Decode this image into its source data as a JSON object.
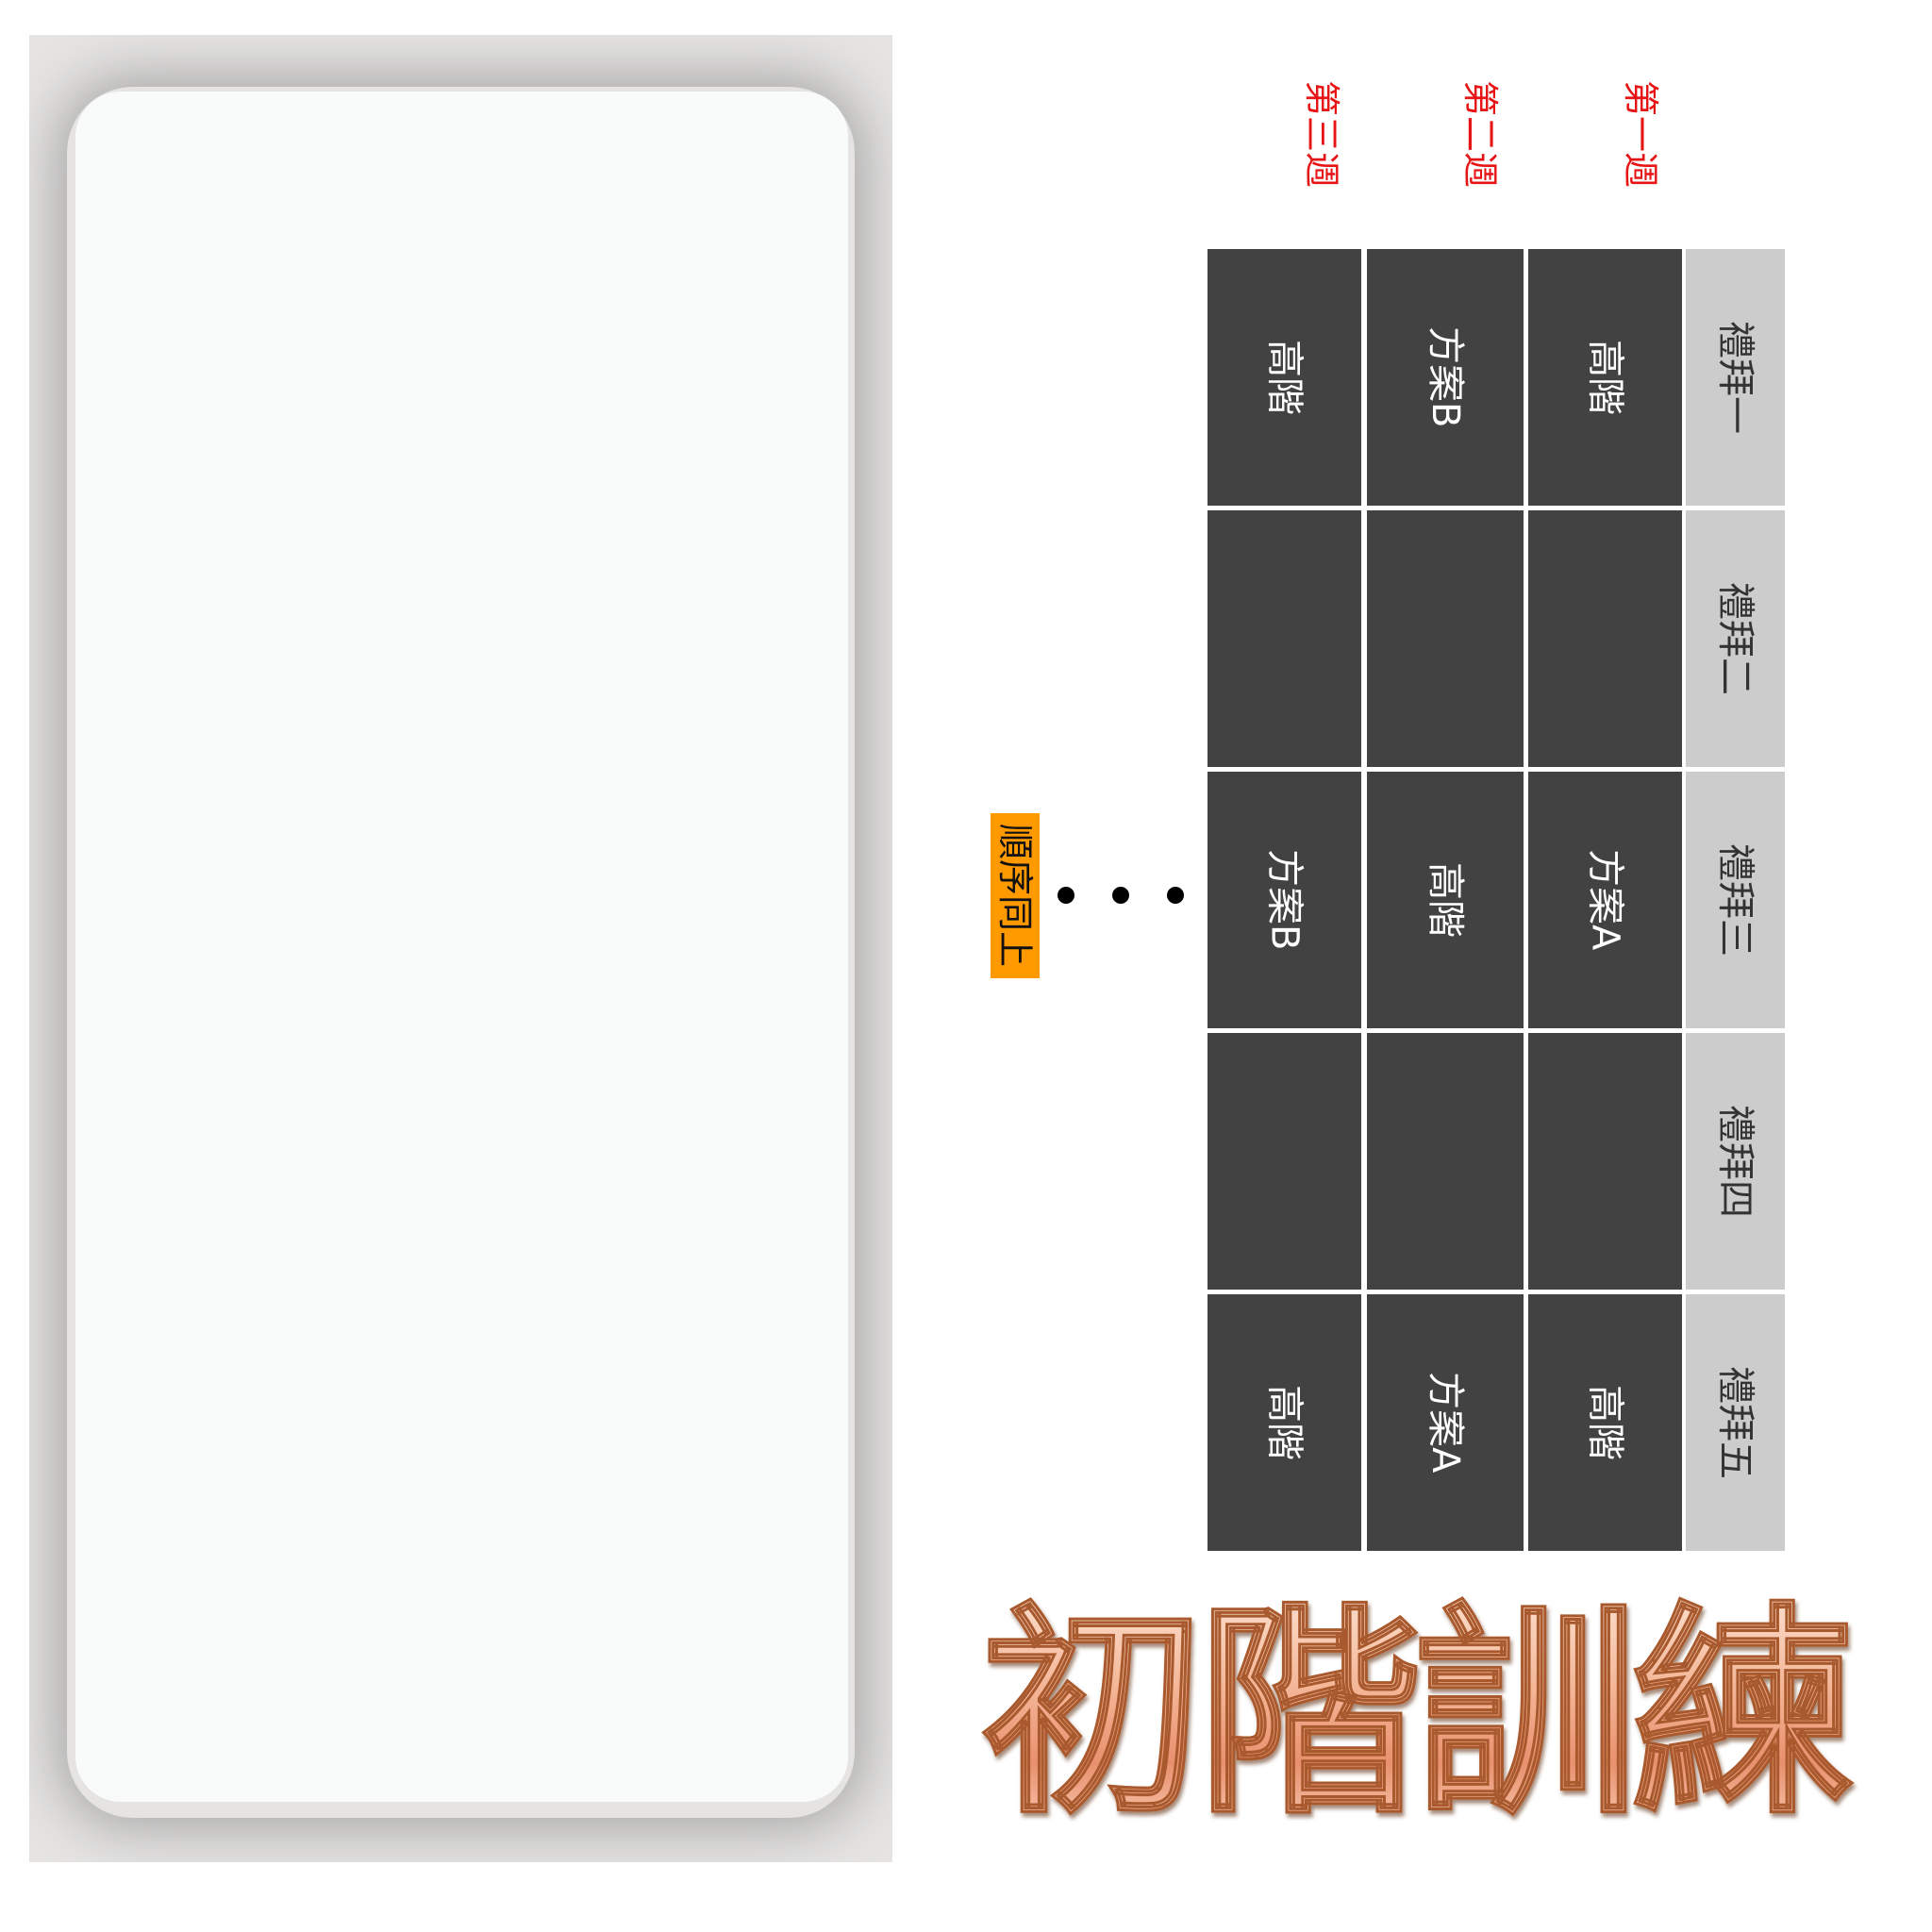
{
  "weeks": [
    "第一週",
    "第二週",
    "第三週"
  ],
  "days": [
    "禮拜一",
    "禮拜二",
    "禮拜三",
    "禮拜四",
    "禮拜五"
  ],
  "schedule": {
    "week1": [
      "高階",
      "",
      "方案A",
      "",
      "高階"
    ],
    "week2": [
      "方案B",
      "",
      "高階",
      "",
      "方案A"
    ],
    "week3": [
      "高階",
      "",
      "方案B",
      "",
      "高階"
    ]
  },
  "continuation": {
    "note": "順序同上"
  },
  "title": "初階訓練",
  "colors": {
    "week_label": "#e61414",
    "cell_bg": "#424242",
    "day_bg": "#cccccc",
    "note_bg": "#ff9900"
  }
}
